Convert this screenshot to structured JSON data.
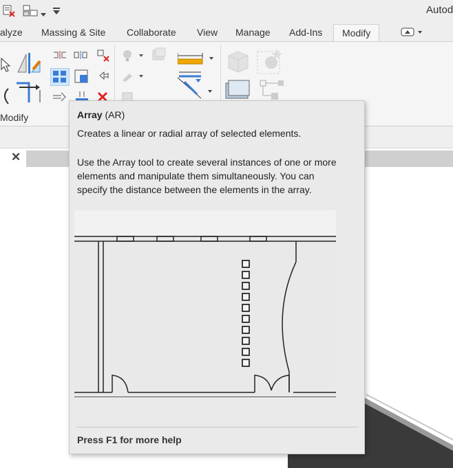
{
  "app": {
    "title_fragment": "Autod"
  },
  "ribbon_tabs": [
    {
      "label": "alyze",
      "active": false
    },
    {
      "label": "Massing & Site",
      "active": false
    },
    {
      "label": "Collaborate",
      "active": false
    },
    {
      "label": "View",
      "active": false
    },
    {
      "label": "Manage",
      "active": false
    },
    {
      "label": "Add-Ins",
      "active": false
    },
    {
      "label": "Modify",
      "active": true
    }
  ],
  "ribbon": {
    "panel_label": "Modify"
  },
  "view_tab": {
    "close_glyph": "✕"
  },
  "tooltip": {
    "title": "Array",
    "shortcut": "(AR)",
    "description": "Creates a linear or radial array of selected elements.",
    "details": [
      "Use the Array tool to create several instances of one or more",
      "elements and manipulate them simultaneously. You can",
      "specify the distance between the elements in the array."
    ],
    "help": "Press F1 for more help"
  },
  "icons": {
    "qat": [
      "close-file-icon",
      "switch-windows-icon",
      "dropdown-arrow-icon",
      "customize-qat-icon"
    ],
    "ribbon": [
      "select-cursor-icon",
      "align-icon",
      "offset-icon",
      "mirror-pick-axis-icon",
      "mirror-draw-axis-icon",
      "split-element-icon",
      "copy-icon",
      "array-icon",
      "scale-icon",
      "pin-icon",
      "unpin-icon",
      "delete-icon",
      "trim-extend-icon",
      "rotate-icon",
      "move-icon",
      "paint-icon",
      "measure-icon",
      "dimension-icon",
      "create-group-icon",
      "create-assembly-icon",
      "view-cube-icon",
      "minimize-ribbon-icon"
    ]
  }
}
